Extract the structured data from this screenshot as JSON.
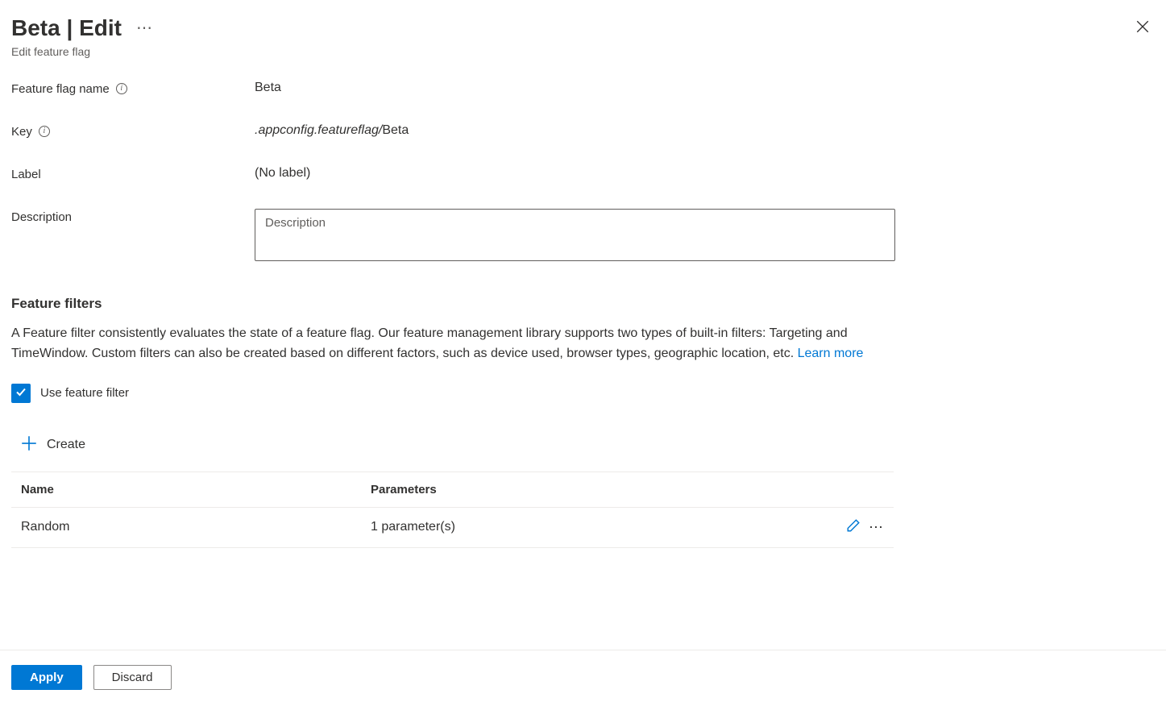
{
  "header": {
    "title": "Beta | Edit",
    "subtitle": "Edit feature flag"
  },
  "form": {
    "name_label": "Feature flag name",
    "name_value": "Beta",
    "key_label": "Key",
    "key_prefix": ".appconfig.featureflag/",
    "key_value": "Beta",
    "label_label": "Label",
    "label_value": "(No label)",
    "description_label": "Description",
    "description_placeholder": "Description"
  },
  "filters": {
    "heading": "Feature filters",
    "description": "A Feature filter consistently evaluates the state of a feature flag. Our feature management library supports two types of built-in filters: Targeting and TimeWindow. Custom filters can also be created based on different factors, such as device used, browser types, geographic location, etc. ",
    "learn_more": "Learn more",
    "checkbox_label": "Use feature filter",
    "checkbox_checked": true,
    "create_label": "Create",
    "table": {
      "col_name": "Name",
      "col_params": "Parameters",
      "rows": [
        {
          "name": "Random",
          "params": "1 parameter(s)"
        }
      ]
    }
  },
  "footer": {
    "apply": "Apply",
    "discard": "Discard"
  }
}
